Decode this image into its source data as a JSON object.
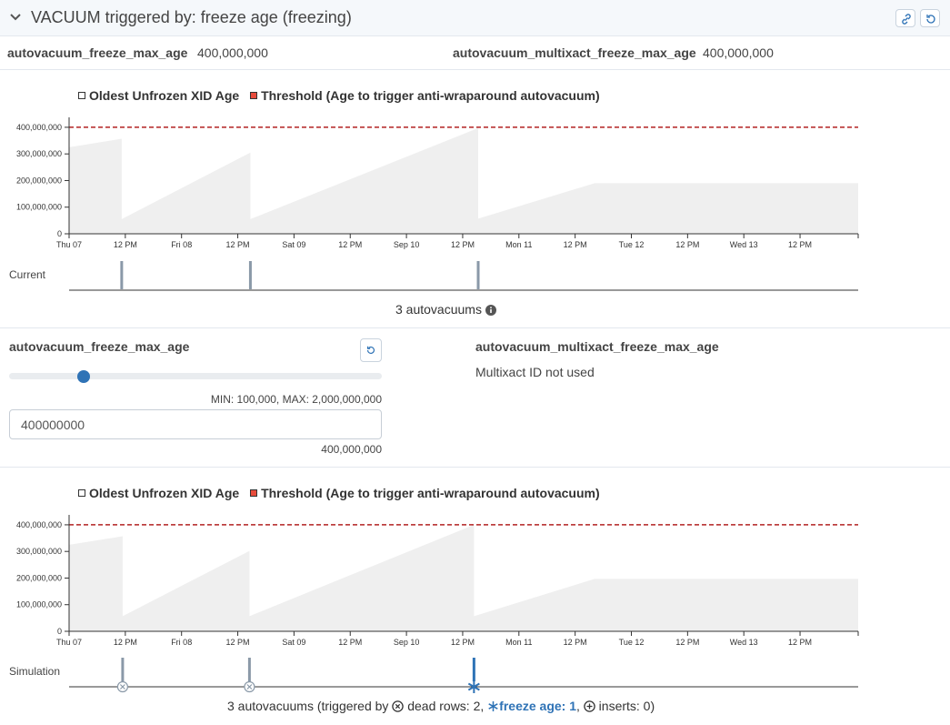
{
  "header": {
    "title": "VACUUM triggered by: freeze age (freezing)",
    "icons": {
      "collapse": "chevron-down-icon",
      "link": "link-icon",
      "reset": "reset-icon"
    }
  },
  "params": {
    "freeze_name": "autovacuum_freeze_max_age",
    "freeze_value": "400,000,000",
    "multixact_name": "autovacuum_multixact_freeze_max_age",
    "multixact_value": "400,000,000"
  },
  "legend": {
    "series1": "Oldest Unfrozen XID Age",
    "series2": "Threshold (Age to trigger anti-wraparound autovacuum)",
    "series1_color": "#ffffff",
    "series2_color": "#e74c3c"
  },
  "current": {
    "row_label": "Current",
    "summary": "3 autovacuums"
  },
  "settings": {
    "freeze_label": "autovacuum_freeze_max_age",
    "slider_fraction": 0.19995,
    "minmax": "MIN: 100,000, MAX: 2,000,000,000",
    "input_value": "400000000",
    "formatted_value": "400,000,000",
    "multixact_label": "autovacuum_multixact_freeze_max_age",
    "multixact_note": "Multixact ID not used"
  },
  "simulation": {
    "row_label": "Simulation",
    "summary_prefix": "3 autovacuums (triggered by",
    "dead_rows": "dead rows: 2,",
    "freeze_age": "freeze age: 1",
    "comma": ",",
    "inserts": "inserts: 0)"
  },
  "colors": {
    "area": "#efefef",
    "threshold": "#b22222",
    "accent": "#2f73b6",
    "marker": "#8a99a8"
  },
  "chart_data": [
    {
      "type": "area",
      "title": "",
      "xlabel": "",
      "ylabel": "",
      "x_range": [
        "Thu 07 00:00",
        "Thu 14 00:00"
      ],
      "y_ticks": [
        "0",
        "100,000,000",
        "200,000,000",
        "300,000,000",
        "400,000,000"
      ],
      "x_ticks": [
        "Thu 07",
        "12 PM",
        "Fri 08",
        "12 PM",
        "Sat 09",
        "12 PM",
        "Sep 10",
        "12 PM",
        "Mon 11",
        "12 PM",
        "Tue 12",
        "12 PM",
        "Wed 13",
        "12 PM"
      ],
      "ylim": [
        0,
        410000000
      ],
      "threshold": 400000000,
      "series": [
        {
          "name": "Oldest Unfrozen XID Age",
          "points": [
            [
              0,
              325000000
            ],
            [
              11.2,
              357000000
            ],
            [
              11.2,
              55000000
            ],
            [
              38.6,
              305000000
            ],
            [
              38.6,
              55000000
            ],
            [
              87.1,
              397000000
            ],
            [
              87.1,
              57000000
            ],
            [
              111.9,
              190000000
            ]
          ]
        }
      ],
      "autovacuum_hours": [
        11.2,
        38.6,
        87.1
      ]
    },
    {
      "type": "area",
      "title": "",
      "xlabel": "",
      "ylabel": "",
      "x_range": [
        "Thu 07 00:00",
        "Thu 14 00:00"
      ],
      "y_ticks": [
        "0",
        "100,000,000",
        "200,000,000",
        "300,000,000",
        "400,000,000"
      ],
      "x_ticks": [
        "Thu 07",
        "12 PM",
        "Fri 08",
        "12 PM",
        "Sat 09",
        "12 PM",
        "Sep 10",
        "12 PM",
        "Mon 11",
        "12 PM",
        "Tue 12",
        "12 PM",
        "Wed 13",
        "12 PM"
      ],
      "ylim": [
        0,
        410000000
      ],
      "threshold": 400000000,
      "series": [
        {
          "name": "Oldest Unfrozen XID Age",
          "points": [
            [
              0,
              325000000
            ],
            [
              11.4,
              357000000
            ],
            [
              11.4,
              57000000
            ],
            [
              38.4,
              302000000
            ],
            [
              38.4,
              57000000
            ],
            [
              86.2,
              400000000
            ],
            [
              86.2,
              57000000
            ],
            [
              111.9,
              197000000
            ]
          ]
        }
      ],
      "autovacuum_hours": [
        11.4,
        38.4,
        86.2
      ],
      "autovacuum_triggers": [
        "dead rows",
        "dead rows",
        "freeze age"
      ]
    }
  ]
}
